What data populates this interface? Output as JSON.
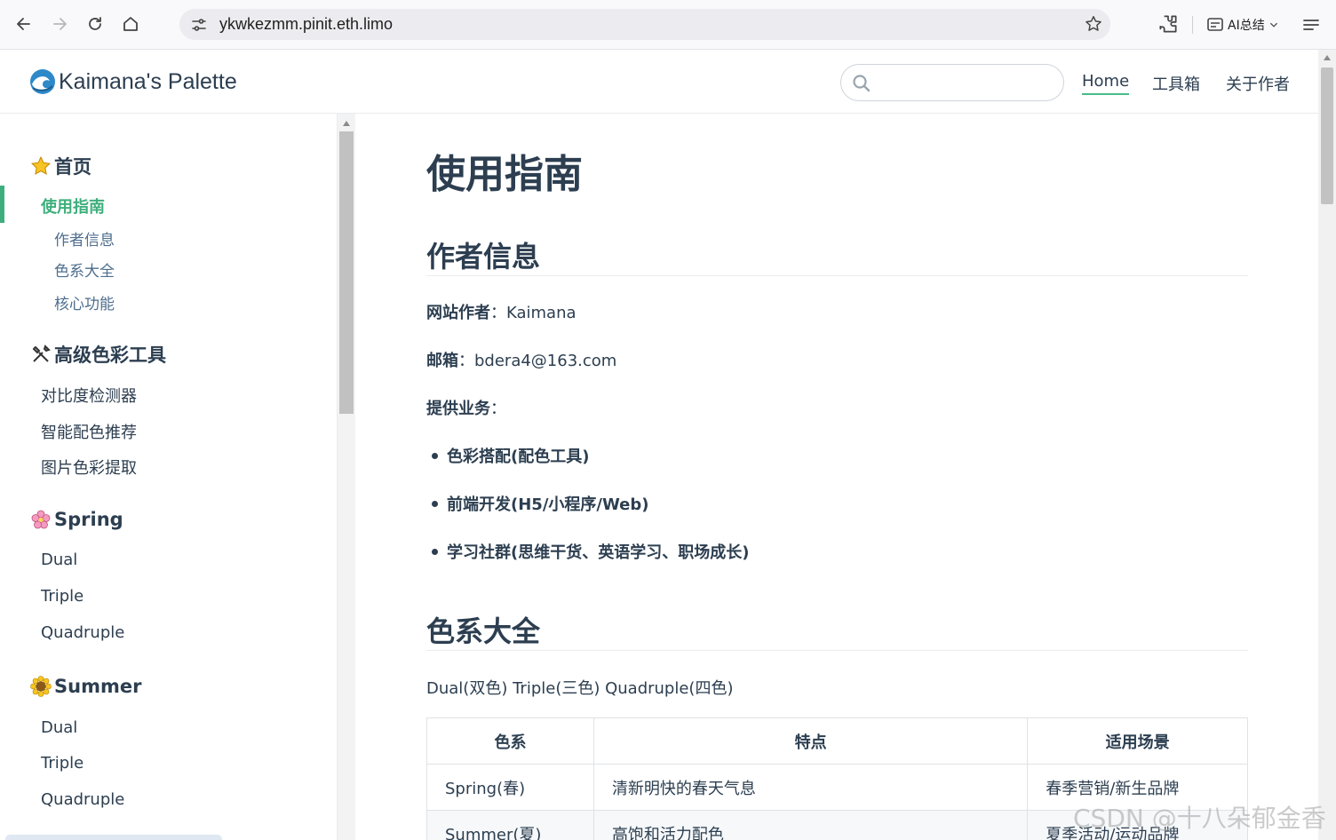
{
  "browser": {
    "url": "ykwkezmm.pinit.eth.limo",
    "ai_summary_label": "AI总结"
  },
  "header": {
    "site_title": "Kaimana's Palette",
    "search_placeholder": "",
    "nav": [
      {
        "label": "Home",
        "active": true
      },
      {
        "label": "工具箱",
        "active": false
      },
      {
        "label": "关于作者",
        "active": false
      }
    ],
    "accent_color": "#3eaf7c"
  },
  "sidebar": {
    "groups": [
      {
        "title": "首页",
        "icon": "star-icon",
        "items": [
          {
            "label": "使用指南",
            "active": true,
            "children": [
              "作者信息",
              "色系大全",
              "核心功能"
            ]
          }
        ]
      },
      {
        "title": "高级色彩工具",
        "icon": "tools-icon",
        "items": [
          {
            "label": "对比度检测器"
          },
          {
            "label": "智能配色推荐"
          },
          {
            "label": "图片色彩提取"
          }
        ]
      },
      {
        "title": "Spring",
        "icon": "cherry-blossom-icon",
        "items": [
          {
            "label": "Dual"
          },
          {
            "label": "Triple"
          },
          {
            "label": "Quadruple"
          }
        ]
      },
      {
        "title": "Summer",
        "icon": "sunflower-icon",
        "items": [
          {
            "label": "Dual"
          },
          {
            "label": "Triple"
          },
          {
            "label": "Quadruple"
          }
        ]
      }
    ]
  },
  "main": {
    "page_title": "使用指南",
    "author_section": {
      "heading": "作者信息",
      "author_label": "网站作者",
      "author_value": "：Kaimana",
      "email_label": "邮箱",
      "email_value": "：bdera4@163.com",
      "services_label": "提供业务",
      "services_suffix": "：",
      "services": [
        "色彩搭配(配色工具)",
        "前端开发(H5/小程序/Web)",
        "学习社群(思维干货、英语学习、职场成长)"
      ]
    },
    "colors_section": {
      "heading": "色系大全",
      "subtitle": "Dual(双色) Triple(三色) Quadruple(四色)",
      "table": {
        "headers": [
          "色系",
          "特点",
          "适用场景"
        ],
        "rows": [
          [
            "Spring(春)",
            "清新明快的春天气息",
            "春季营销/新生品牌"
          ],
          [
            "Summer(夏)",
            "高饱和活力配色",
            "夏季活动/运动品牌"
          ]
        ]
      }
    }
  },
  "watermark": "CSDN @十八朵郁金香"
}
